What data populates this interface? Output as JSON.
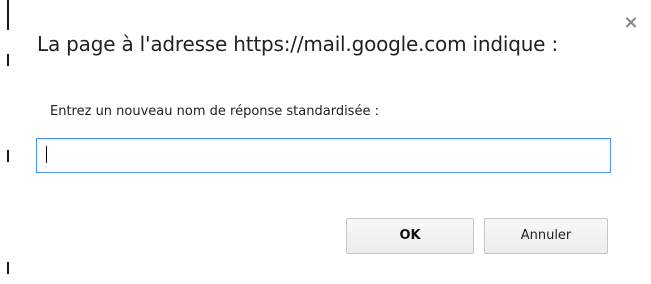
{
  "dialog": {
    "title": "La page à l'adresse https://mail.google.com indique :",
    "close_icon": "×",
    "prompt_label": "Entrez un nouveau nom de réponse standardisée :",
    "input_value": "",
    "ok_label": "OK",
    "cancel_label": "Annuler"
  }
}
